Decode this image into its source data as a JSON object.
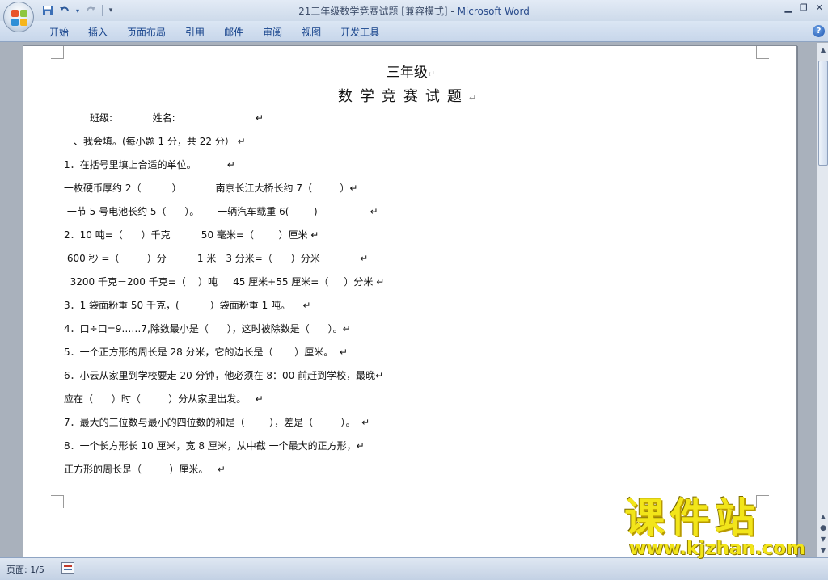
{
  "window": {
    "title": "21三年级数学竞赛试题 [兼容模式] - ",
    "app_name": "Microsoft Word",
    "controls": [
      "minimize-icon",
      "restore-icon",
      "close-icon"
    ]
  },
  "quick_access": {
    "icons": [
      "save-icon",
      "undo-icon",
      "undo-dropdown-icon",
      "redo-icon",
      "customize-toolbar-icon"
    ]
  },
  "ribbon": {
    "tabs": [
      "开始",
      "插入",
      "页面布局",
      "引用",
      "邮件",
      "审阅",
      "视图",
      "开发工具"
    ],
    "help_icon": "help-icon"
  },
  "document": {
    "title": "三年级",
    "subtitle": "数学竞赛试题",
    "paragraph_mark": "↵",
    "lines": [
      "班级:             姓名:                          ↵",
      "一、我会填。(每小题 1 分，共 22 分） ↵",
      "1．在括号里填上合适的单位。          ↵",
      "一枚硬币厚约 2（          ）           南京长江大桥长约 7（         ）↵",
      " 一节 5 号电池长约 5（      ）。      一辆汽车载重 6(        )                 ↵",
      "2．10 吨=（      ）千克          50 毫米=（        ）厘米 ↵",
      " 600 秒 =（         ）分          1 米－3 分米=（      ）分米             ↵",
      "  3200 千克－200 千克=（    ）吨     45 厘米+55 厘米=（     ）分米 ↵",
      "3．1 袋面粉重 50 千克，(          ）袋面粉重 1 吨。    ↵",
      "4．口÷口=9……7,除数最小是（      ），这时被除数是（      ）。↵",
      "5．一个正方形的周长是 28 分米，它的边长是（       ）厘米。  ↵",
      "6．小云从家里到学校要走 20 分钟，他必须在 8：00 前赶到学校，最晚↵",
      "应在（      ）时（         ）分从家里出发。   ↵",
      "7．最大的三位数与最小的四位数的和是（        ），差是（         ）。  ↵",
      "8．一个长方形长 10 厘米，宽 8 厘米，从中截 一个最大的正方形，↵",
      "正方形的周长是（         ）厘米。   ↵"
    ]
  },
  "status_bar": {
    "page_info": "页面: 1/5",
    "proofing_icon": "proofing-icon"
  },
  "watermark": {
    "name": "课件站",
    "url": "www.kjzhan.com"
  },
  "colors": {
    "ribbon_text": "#15428b",
    "watermark_yellow": "#f2e51a",
    "app_background": "#a9b1bc"
  }
}
